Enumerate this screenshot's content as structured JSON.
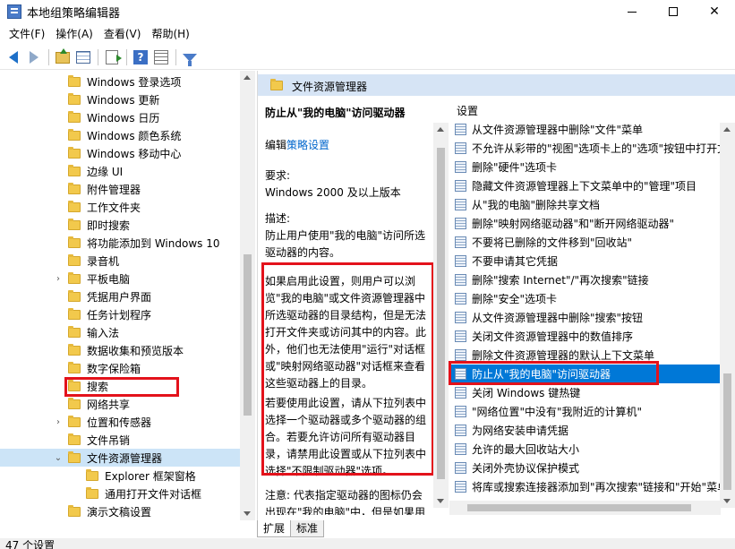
{
  "window": {
    "title": "本地组策略编辑器",
    "controls": [
      "minimize",
      "maximize",
      "close"
    ]
  },
  "menu": [
    "文件(F)",
    "操作(A)",
    "查看(V)",
    "帮助(H)"
  ],
  "toolbar": {
    "icons": [
      "back-arrow-icon",
      "forward-arrow-icon",
      "up-folder-icon",
      "show-hide-tree-icon",
      "export-list-icon",
      "help-icon",
      "properties-icon",
      "filter-icon"
    ]
  },
  "tree": {
    "items": [
      {
        "label": "Windows 登录选项",
        "expander": ""
      },
      {
        "label": "Windows 更新",
        "expander": ""
      },
      {
        "label": "Windows 日历",
        "expander": ""
      },
      {
        "label": "Windows 颜色系统",
        "expander": ""
      },
      {
        "label": "Windows 移动中心",
        "expander": ""
      },
      {
        "label": "边缘 UI",
        "expander": ""
      },
      {
        "label": "附件管理器",
        "expander": ""
      },
      {
        "label": "工作文件夹",
        "expander": ""
      },
      {
        "label": "即时搜索",
        "expander": ""
      },
      {
        "label": "将功能添加到 Windows 10",
        "expander": ""
      },
      {
        "label": "录音机",
        "expander": ""
      },
      {
        "label": "平板电脑",
        "expander": "›"
      },
      {
        "label": "凭据用户界面",
        "expander": ""
      },
      {
        "label": "任务计划程序",
        "expander": ""
      },
      {
        "label": "输入法",
        "expander": ""
      },
      {
        "label": "数据收集和预览版本",
        "expander": ""
      },
      {
        "label": "数字保险箱",
        "expander": ""
      },
      {
        "label": "搜索",
        "expander": ""
      },
      {
        "label": "网络共享",
        "expander": ""
      },
      {
        "label": "位置和传感器",
        "expander": "›"
      },
      {
        "label": "文件吊销",
        "expander": ""
      },
      {
        "label": "文件资源管理器",
        "expander": "⌄",
        "selected": true
      },
      {
        "label": "Explorer 框架窗格",
        "expander": "",
        "indent": 1
      },
      {
        "label": "通用打开文件对话框",
        "expander": "",
        "indent": 1
      },
      {
        "label": "演示文稿设置",
        "expander": ""
      }
    ]
  },
  "header": {
    "title": "文件资源管理器"
  },
  "description": {
    "title": "防止从\"我的电脑\"访问驱动器",
    "edit_prefix": "编辑",
    "edit_link": "策略设置",
    "requirements_label": "要求:",
    "requirements_value": "Windows 2000 及以上版本",
    "description_label": "描述:",
    "description_value": "防止用户使用\"我的电脑\"访问所选驱动器的内容。",
    "body1": "如果启用此设置，则用户可以浏览\"我的电脑\"或文件资源管理器中所选驱动器的目录结构，但是无法打开文件夹或访问其中的内容。此外，他们也无法使用\"运行\"对话框或\"映射网络驱动器\"对话框来查看这些驱动器上的目录。",
    "body2": "若要使用此设置，请从下拉列表中选择一个驱动器或多个驱动器的组合。若要允许访问所有驱动器目录，请禁用此设置或从下拉列表中选择\"不限制驱动器\"选项。",
    "note": "注意: 代表指定驱动器的图标仍会出现在\"我的电脑\"中，但是如果用"
  },
  "settings": {
    "column_header": "设置",
    "items": [
      "从文件资源管理器中删除\"文件\"菜单",
      "不允许从彩带的\"视图\"选项卡上的\"选项\"按钮中打开文",
      "删除\"硬件\"选项卡",
      "隐藏文件资源管理器上下文菜单中的\"管理\"项目",
      "从\"我的电脑\"删除共享文档",
      "删除\"映射网络驱动器\"和\"断开网络驱动器\"",
      "不要将已删除的文件移到\"回收站\"",
      "不要申请其它凭据",
      "删除\"搜索 Internet\"/\"再次搜索\"链接",
      "删除\"安全\"选项卡",
      "从文件资源管理器中删除\"搜索\"按钮",
      "关闭文件资源管理器中的数值排序",
      "删除文件资源管理器的默认上下文菜单",
      "防止从\"我的电脑\"访问驱动器",
      "关闭 Windows 键热键",
      "\"网络位置\"中没有\"我附近的计算机\"",
      "为网络安装申请凭据",
      "允许的最大回收站大小",
      "关闭外壳协议保护模式",
      "将库或搜索连接器添加到\"再次搜索\"链接和\"开始\"菜单"
    ],
    "selected_index": 13
  },
  "tabs": [
    "扩展",
    "标准"
  ],
  "active_tab": 0,
  "status": {
    "text": "47 个设置"
  },
  "colors": {
    "selection": "#0078d7",
    "highlight_box": "#e3121b",
    "header_band": "#d6e4f5",
    "link": "#0066cc"
  }
}
